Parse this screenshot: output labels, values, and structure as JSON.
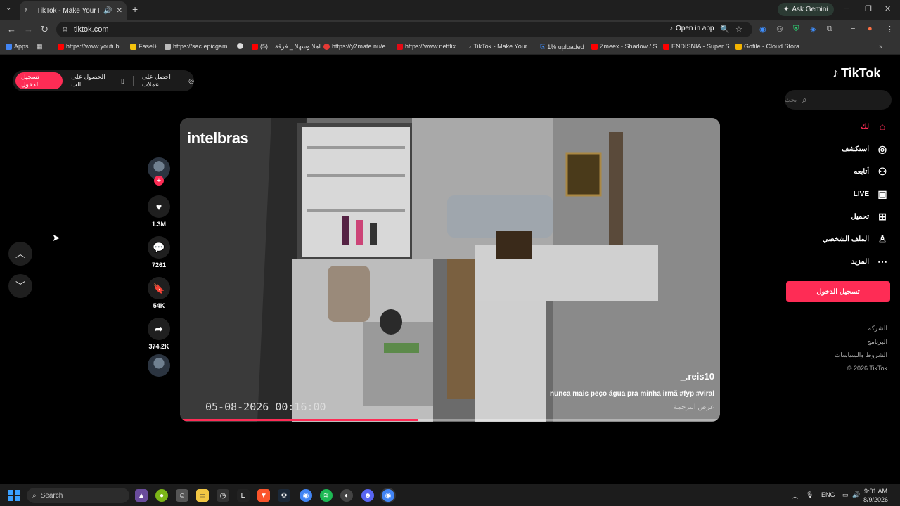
{
  "browser": {
    "tab_title": "TikTok - Make Your Day",
    "ask_gemini": "Ask Gemini",
    "url": "tiktok.com",
    "open_in_app": "Open in app",
    "bookmarks": [
      {
        "label": "Apps",
        "color": "#4285f4"
      },
      {
        "label": "https://www.youtub...",
        "color": "#ff0000"
      },
      {
        "label": "Fasel+",
        "color": "#f4c20d"
      },
      {
        "label": "https://sac.epicgam...",
        "color": "#bbbbbb"
      },
      {
        "label": "",
        "color": "#dddddd"
      },
      {
        "label": "اهلا وسهلا _ فرقة... (5)",
        "color": "#ff0000"
      },
      {
        "label": "https://y2mate.nu/e...",
        "color": "#e53935"
      },
      {
        "label": "https://www.netflix....",
        "color": "#e50914"
      },
      {
        "label": "TikTok - Make Your...",
        "color": "#ffffff"
      },
      {
        "label": "1% uploaded",
        "color": "#3f8efc"
      },
      {
        "label": "Zmeex - Shadow / S...",
        "color": "#ff0000"
      },
      {
        "label": "ENDISNIA - Super S...",
        "color": "#ff0000"
      },
      {
        "label": "Gofile - Cloud Stora...",
        "color": "#f4b400"
      }
    ]
  },
  "tiktok": {
    "login_pill": "تسجيل الدخول",
    "get_app": "الحصول على الت...",
    "get_coins": "احصل على عملات",
    "logo": "TikTok",
    "search_placeholder": "بحث",
    "nav": [
      {
        "label": "لك",
        "icon": "home-icon",
        "active": true
      },
      {
        "label": "استكشف",
        "icon": "compass-icon",
        "active": false
      },
      {
        "label": "أتابعه",
        "icon": "following-icon",
        "active": false
      },
      {
        "label": "LIVE",
        "icon": "live-icon",
        "active": false
      },
      {
        "label": "تحميل",
        "icon": "upload-icon",
        "active": false
      },
      {
        "label": "الملف الشخصي",
        "icon": "profile-icon",
        "active": false
      },
      {
        "label": "المزيد",
        "icon": "more-icon",
        "active": false
      }
    ],
    "side_login": "تسجيل الدخول",
    "footer": [
      "الشركة",
      "البرنامج",
      "الشروط والسياسات",
      "© 2026 TikTok"
    ],
    "video": {
      "watermark": "intelbras",
      "camera_timestamp": "05-08-2026 00:16:00",
      "author": "_.reis10",
      "caption": "nunca mais peço água pra minha irmã #fyp #viral",
      "translate": "عرض الترجمة",
      "progress": 0.44
    },
    "actions": {
      "likes": "1.3M",
      "comments": "7261",
      "saves": "54K",
      "shares": "374.2K"
    }
  },
  "taskbar": {
    "search": "Search",
    "lang": "ENG",
    "time": "9:01 AM",
    "date": "8/9/2026"
  },
  "colors": {
    "accent": "#fe2c55",
    "background": "#000000"
  }
}
